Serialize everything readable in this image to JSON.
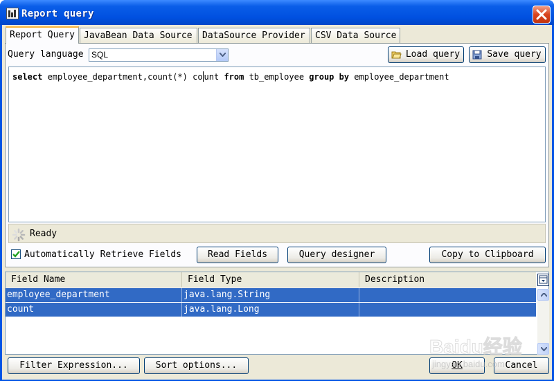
{
  "window": {
    "title": "Report query"
  },
  "tabs": [
    {
      "label": "Report Query"
    },
    {
      "label": "JavaBean Data Source"
    },
    {
      "label": "DataSource Provider"
    },
    {
      "label": "CSV Data Source"
    }
  ],
  "query": {
    "language_label": "Query language",
    "language_value": "SQL",
    "load_label": "Load query",
    "save_label": "Save query",
    "sql_parts": {
      "p1": "select",
      "p2": " employee_department,count(*) co",
      "p3": "unt ",
      "p4": "from",
      "p5": " tb_employee ",
      "p6": "group by",
      "p7": " employee_department"
    },
    "status": "Ready"
  },
  "controls": {
    "auto_retrieve_label": "Automatically Retrieve Fields",
    "auto_retrieve_checked": true,
    "read_fields": "Read Fields",
    "query_designer": "Query designer",
    "copy_clipboard": "Copy to Clipboard"
  },
  "fields": {
    "columns": [
      "Field Name",
      "Field Type",
      "Description"
    ],
    "rows": [
      {
        "name": "employee_department",
        "type": "java.lang.String",
        "description": ""
      },
      {
        "name": "count",
        "type": "java.lang.Long",
        "description": ""
      }
    ]
  },
  "footer": {
    "filter": "Filter Expression...",
    "sort": "Sort options...",
    "ok": "OK",
    "cancel": "Cancel"
  },
  "watermark": {
    "text": "Baidu经验",
    "sub": "jingyan.baidu.com"
  },
  "colors": {
    "titlebar": "#0a5ee8",
    "selection": "#316ac5",
    "dialog": "#ece9d8"
  }
}
